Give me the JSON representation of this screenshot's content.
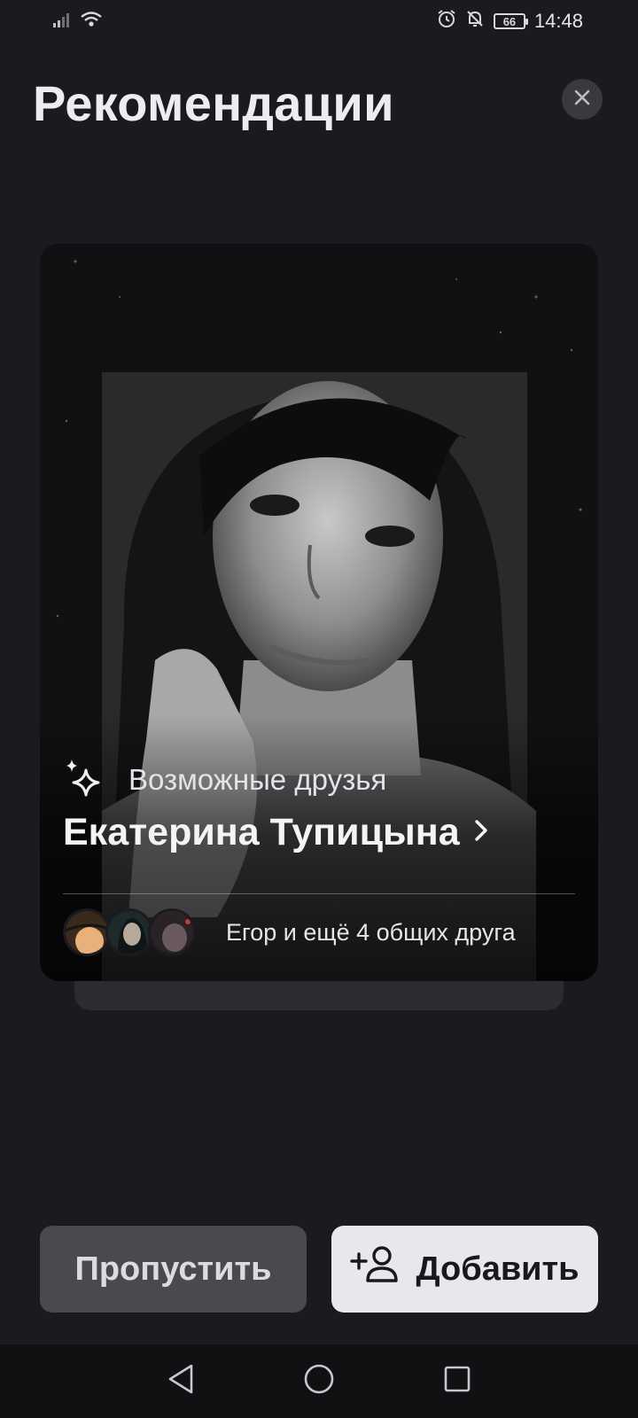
{
  "status_bar": {
    "time": "14:48",
    "battery": "66",
    "icons": [
      "signal-icon",
      "wifi-icon",
      "alarm-icon",
      "bell-muted-icon",
      "battery-icon"
    ]
  },
  "header": {
    "title": "Рекомендации",
    "close_icon": "close-icon"
  },
  "card": {
    "subtitle": "Возможные друзья",
    "name": "Екатерина Тупицына",
    "mutual_text": "Егор и ещё 4 общих друга",
    "mutual_avatar_count": 3
  },
  "actions": {
    "skip_label": "Пропустить",
    "add_label": "Добавить",
    "add_icon": "add-user-icon"
  },
  "nav": [
    "back-icon",
    "home-icon",
    "recents-icon"
  ],
  "colors": {
    "background": "#1b1a1f",
    "skip_button": "#4a494f",
    "add_button": "#e8e8ec"
  }
}
